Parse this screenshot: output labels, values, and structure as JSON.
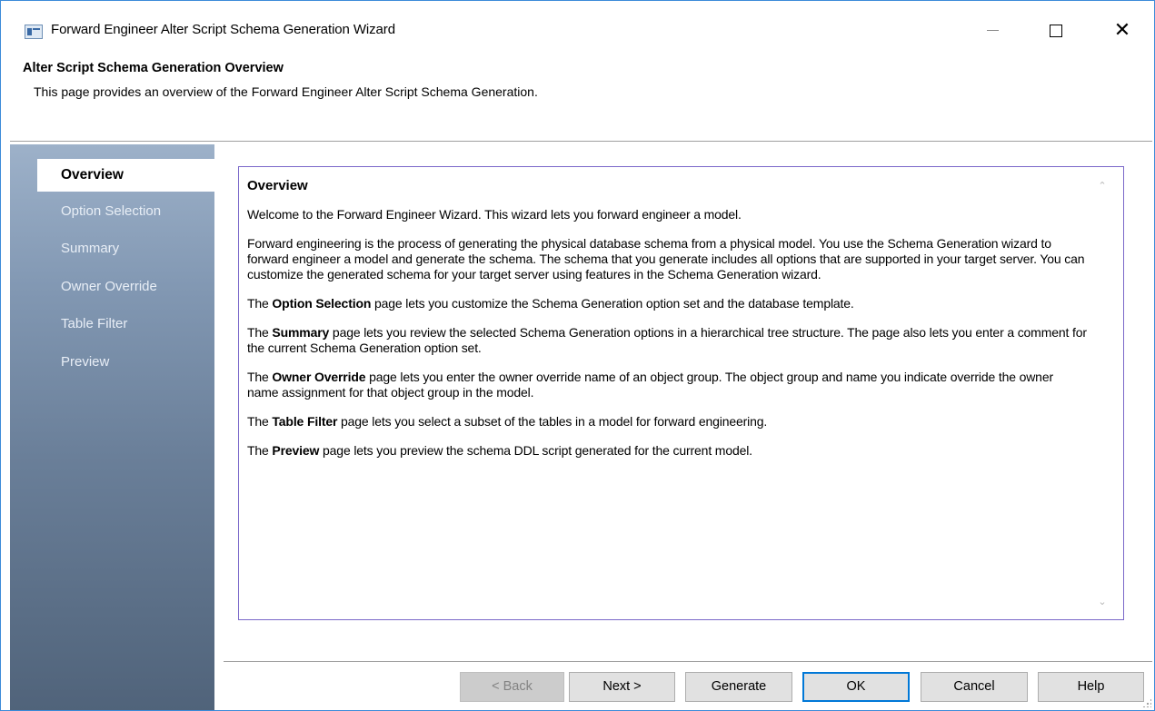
{
  "window": {
    "title": "Forward Engineer Alter Script Schema Generation Wizard",
    "controls": {
      "minimize": "—",
      "maximize": "",
      "close": "✕"
    }
  },
  "header": {
    "title": "Alter Script Schema Generation Overview",
    "description": "This page provides an overview of the Forward Engineer Alter Script Schema Generation."
  },
  "sidebar": {
    "items": [
      {
        "label": "Overview",
        "active": true
      },
      {
        "label": "Option Selection",
        "active": false
      },
      {
        "label": "Summary",
        "active": false
      },
      {
        "label": "Owner Override",
        "active": false
      },
      {
        "label": "Table Filter",
        "active": false
      },
      {
        "label": "Preview",
        "active": false
      }
    ]
  },
  "content": {
    "heading": "Overview",
    "welcome": "Welcome to the Forward Engineer Wizard. This wizard lets you forward engineer a model.",
    "intro": "Forward engineering is the process of generating the physical database schema from a physical model. You use the Schema Generation wizard to forward engineer a model and generate the schema. The schema that you generate includes all options that are supported in your target server. You can customize the generated schema for your target server using features in the Schema Generation wizard.",
    "paragraphs": [
      {
        "lead": "The ",
        "term": "Option Selection",
        "text": " page lets you customize the Schema Generation option set and the database template."
      },
      {
        "lead": "The ",
        "term": "Summary",
        "text": " page lets you review the selected Schema Generation options in a hierarchical tree structure. The page also lets you enter a comment for the current Schema Generation option set."
      },
      {
        "lead": "The ",
        "term": "Owner Override",
        "text": " page lets you enter the owner override name of an object group. The object group and name you indicate override the owner name assignment for that object group in the model."
      },
      {
        "lead": "The ",
        "term": "Table Filter",
        "text": " page lets you select a subset of the tables in a model for forward engineering."
      },
      {
        "lead": "The ",
        "term": "Preview",
        "text": " page lets you preview the schema DDL script generated for the current model."
      }
    ],
    "scroll_up": "⌃",
    "scroll_down": "⌄"
  },
  "buttons": {
    "back": "< Back",
    "next": "Next >",
    "generate": "Generate",
    "ok": "OK",
    "cancel": "Cancel",
    "help": "Help"
  },
  "colors": {
    "accent": "#0078d7",
    "sidebar_top": "#9db1c9",
    "sidebar_bottom": "#50637a",
    "content_border": "#7a68c9"
  }
}
